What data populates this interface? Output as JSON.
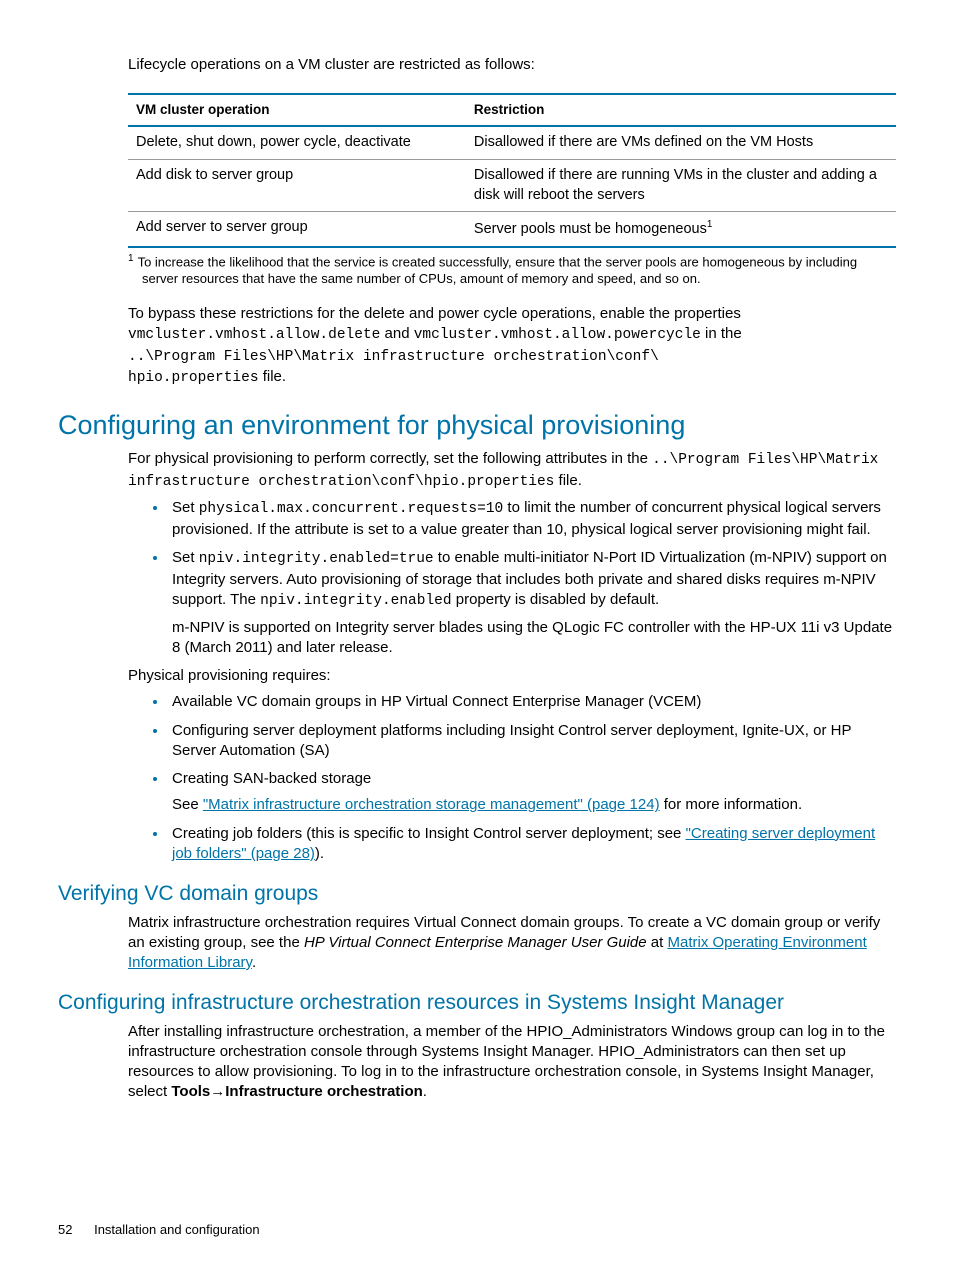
{
  "intro": "Lifecycle operations on a VM cluster are restricted as follows:",
  "table": {
    "headers": [
      "VM cluster operation",
      "Restriction"
    ],
    "rows": [
      [
        "Delete, shut down, power cycle, deactivate",
        "Disallowed if there are VMs defined on the VM Hosts"
      ],
      [
        "Add disk to server group",
        "Disallowed if there are running VMs in the cluster and adding a disk will reboot the servers"
      ],
      [
        "Add server to server group",
        "Server pools must be homogeneous"
      ]
    ],
    "sup": "1"
  },
  "footnote": {
    "num": "1",
    "text": "To increase the likelihood that the service is created successfully, ensure that the server pools are homogeneous by including server resources that have the same number of CPUs, amount of memory and speed, and so on."
  },
  "bypass": {
    "t1": "To bypass these restrictions for the delete and power cycle operations, enable the properties ",
    "c1": "vmcluster.vmhost.allow.delete",
    "t2": " and ",
    "c2": "vmcluster.vmhost.allow.powercycle",
    "t3": " in the ",
    "c3": "..\\Program Files\\HP\\Matrix infrastructure orchestration\\conf\\",
    "c4": "hpio.properties",
    "t4": " file."
  },
  "h1": "Configuring an environment for physical provisioning",
  "para1": {
    "t1": "For physical provisioning to perform correctly, set the following attributes in the ",
    "c1": "..\\Program Files\\HP\\Matrix infrastructure orchestration\\conf\\hpio.properties",
    "t2": " file."
  },
  "bullets1": {
    "b1": {
      "t1": "Set ",
      "c1": "physical.max.concurrent.requests=10",
      "t2": " to limit the number of concurrent physical logical servers provisioned. If the attribute is set to a value greater than 10, physical logical server provisioning might fail."
    },
    "b2": {
      "t1": "Set ",
      "c1": "npiv.integrity.enabled=true",
      "t2": " to enable multi-initiator N-Port ID Virtualization (m-NPIV) support on Integrity servers. Auto provisioning of storage that includes both private and shared disks requires m-NPIV support. The ",
      "c2": "npiv.integrity.enabled",
      "t3": " property is disabled by default.",
      "sub": "m-NPIV is supported on Integrity server blades using the QLogic FC controller with the HP-UX 11i v3 Update 8 (March 2011) and later release."
    }
  },
  "req_intro": "Physical provisioning requires:",
  "bullets2": {
    "b1": "Available VC domain groups in HP Virtual Connect Enterprise Manager (VCEM)",
    "b2": "Configuring server deployment platforms including Insight Control server deployment, Ignite-UX, or HP Server Automation (SA)",
    "b3": {
      "t1": "Creating SAN-backed storage",
      "sub_pre": "See ",
      "link": "\"Matrix infrastructure orchestration storage management\" (page 124)",
      "sub_post": " for more information."
    },
    "b4": {
      "t1": "Creating job folders (this is specific to Insight Control server deployment; see ",
      "link": "\"Creating server deployment job folders\" (page 28)",
      "t2": ")."
    }
  },
  "h2a": "Verifying VC domain groups",
  "vc": {
    "t1": "Matrix infrastructure orchestration requires Virtual Connect domain groups. To create a VC domain group or verify an existing group, see the ",
    "italic": "HP Virtual Connect Enterprise Manager User Guide",
    "t2": " at ",
    "link": "Matrix Operating Environment Information Library",
    "t3": "."
  },
  "h2b": "Configuring infrastructure orchestration resources in Systems Insight Manager",
  "sim": {
    "t1": "After installing infrastructure orchestration, a member of the HPIO_Administrators Windows group can log in to the infrastructure orchestration console through Systems Insight Manager. HPIO_Administrators can then set up resources to allow provisioning. To log in to the infrastructure orchestration console, in Systems Insight Manager, select ",
    "bold1": "Tools",
    "arrow": "→",
    "bold2": "Infrastructure orchestration",
    "t2": "."
  },
  "footer": {
    "page": "52",
    "section": "Installation and configuration"
  }
}
